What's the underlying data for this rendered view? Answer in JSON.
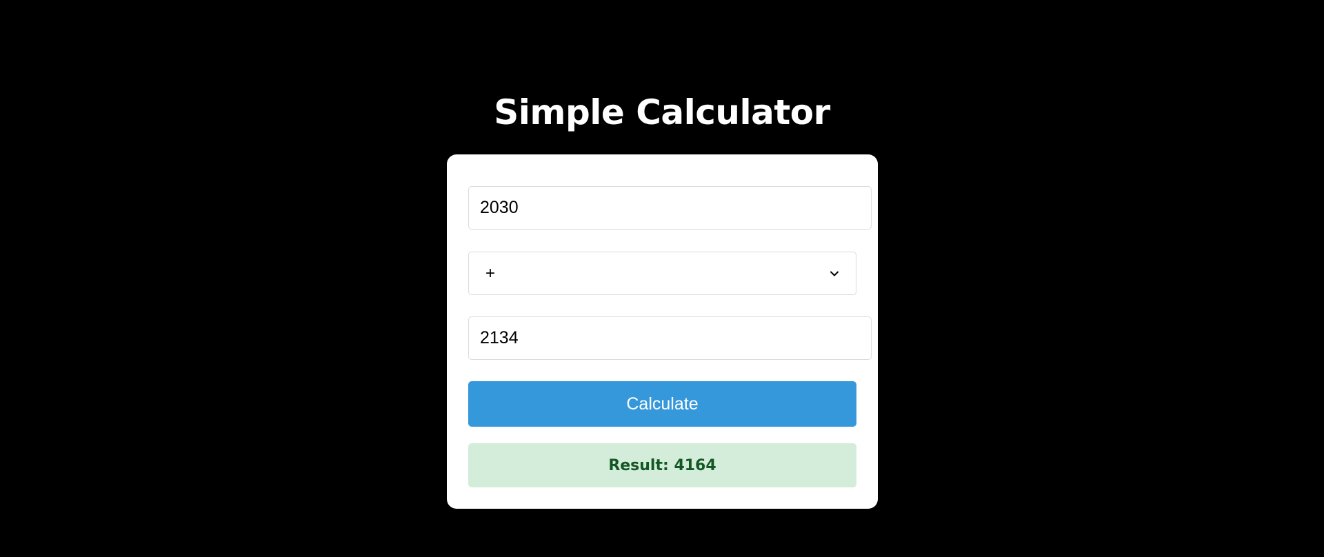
{
  "page": {
    "title": "Simple Calculator"
  },
  "calculator": {
    "first_number": "2030",
    "operator": {
      "selected": "+",
      "icon": "chevron-down-icon"
    },
    "second_number": "2134",
    "calculate_label": "Calculate",
    "result_label": "Result: 4164"
  },
  "colors": {
    "background": "#000000",
    "card": "#ffffff",
    "button": "#3498db",
    "result_bg": "#d4edda",
    "result_text": "#155724"
  }
}
